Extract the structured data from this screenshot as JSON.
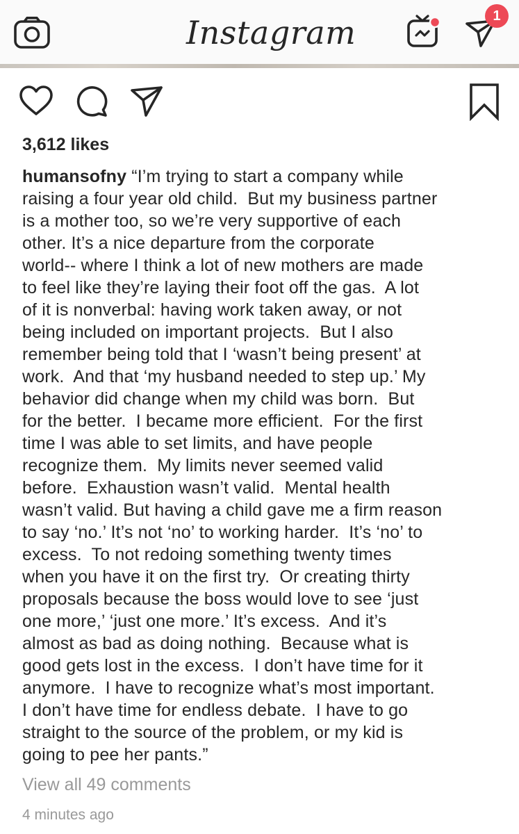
{
  "header": {
    "logo_text": "Instagram",
    "notification_count": "1",
    "badge_color": "#ed4956"
  },
  "icons": {
    "camera": "camera-icon",
    "igtv": "igtv-icon",
    "direct": "direct-message-icon",
    "like": "heart-icon",
    "comment": "comment-icon",
    "share": "share-icon",
    "save": "bookmark-icon"
  },
  "post": {
    "likes": "3,612 likes",
    "username": "humansofny",
    "caption_lines": [
      " “I’m trying to start a company while",
      "raising a four year old child.  But my business partner",
      "is a mother too, so we’re very supportive of each",
      "other. It’s a nice departure from the corporate",
      "world-- where I think a lot of new mothers are made",
      "to feel like they’re laying their foot off the gas.  A lot",
      "of it is nonverbal: having work taken away, or not",
      "being included on important projects.  But I also",
      "remember being told that I ‘wasn’t being present’ at",
      "work.  And that ‘my husband needed to step up.’ My",
      "behavior did change when my child was born.  But",
      "for the better.  I became more efficient.  For the first",
      "time I was able to set limits, and have people",
      "recognize them.  My limits never seemed valid",
      "before.  Exhaustion wasn’t valid.  Mental health",
      "wasn’t valid. But having a child gave me a firm reason",
      "to say ‘no.’ It’s not ‘no’ to working harder.  It’s ‘no’ to",
      "excess.  To not redoing something twenty times",
      "when you have it on the first try.  Or creating thirty",
      "proposals because the boss would love to see ‘just",
      "one more,’ ‘just one more.’ It’s excess.  And it’s",
      "almost as bad as doing nothing.  Because what is",
      "good gets lost in the excess.  I don’t have time for it",
      "anymore.  I have to recognize what’s most important.",
      "I don’t have time for endless debate.  I have to go",
      "straight to the source of the problem, or my kid is",
      "going to pee her pants.”"
    ],
    "view_comments": "View all 49 comments",
    "timestamp": "4 minutes ago"
  }
}
